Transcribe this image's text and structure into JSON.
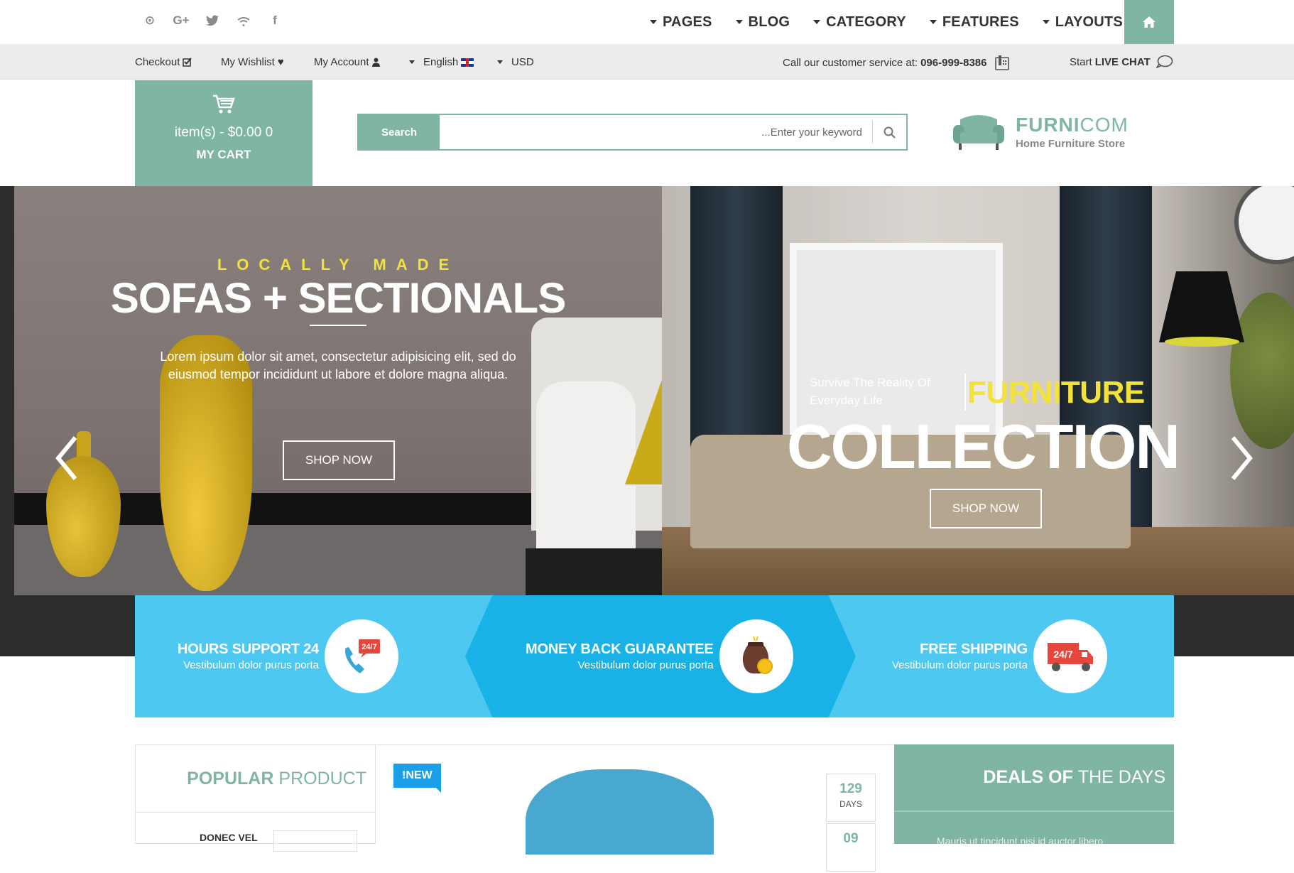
{
  "social": {
    "icons": [
      "podcast-icon",
      "google-plus-icon",
      "twitter-icon",
      "wifi-icon",
      "facebook-icon"
    ],
    "glyphs": [
      "⊙",
      "G+",
      "🐦",
      "≋",
      "f"
    ]
  },
  "nav": {
    "items": [
      "PAGES",
      "BLOG",
      "CATEGORY",
      "FEATURES",
      "LAYOUTS"
    ],
    "home_icon": "home-icon"
  },
  "util": {
    "checkout": "Checkout",
    "wishlist": "My Wishlist",
    "account": "My Account",
    "language": "English",
    "currency": "USD",
    "service_prefix": "Call our customer service at:",
    "service_phone": "096-999-8386",
    "chat_prefix": "Start",
    "chat_label": "LIVE CHAT"
  },
  "cart": {
    "items_text": "item(s) - $0.00 0",
    "label": "MY CART"
  },
  "search": {
    "button": "Search",
    "placeholder": "...Enter your keyword"
  },
  "logo": {
    "name_bold": "FURNI",
    "name_light": "COM",
    "tagline": "Home Furniture Store"
  },
  "hero": {
    "left": {
      "eyebrow": "LOCALLY MADE",
      "title": "SOFAS + SECTIONALS",
      "text": "Lorem ipsum dolor sit amet, consectetur adipisicing elit, sed do eiusmod tempor incididunt ut labore et dolore magna aliqua.",
      "cta": "SHOP NOW"
    },
    "right": {
      "survive": "Survive The Reality Of Everyday Life",
      "word1": "FURNITURE",
      "word2": "COLLECTION",
      "cta": "SHOP NOW"
    }
  },
  "features": [
    {
      "title": "HOURS SUPPORT 24",
      "sub": "Vestibulum dolor purus porta",
      "icon": "phone-24-7-icon"
    },
    {
      "title": "MONEY BACK GUARANTEE",
      "sub": "Vestibulum dolor purus porta",
      "icon": "wallet-coin-icon"
    },
    {
      "title": "FREE SHIPPING",
      "sub": "Vestibulum dolor purus porta",
      "icon": "truck-24-7-icon"
    }
  ],
  "popular": {
    "title_bold": "POPULAR",
    "title_light": "PRODUCT",
    "first_item": "DONEC VEL"
  },
  "product": {
    "badge": "!NEW"
  },
  "countdown": [
    {
      "value": "129",
      "label": "DAYS"
    },
    {
      "value": "09",
      "label": ""
    }
  ],
  "deals": {
    "title_bold": "DEALS OF",
    "title_light": "THE DAYS",
    "text": "Mauris ut tincidunt nisi id auctor libero"
  },
  "colors": {
    "accent": "#7fb5a2",
    "feature_blue": "#4cc8f1",
    "feature_blue_dark": "#19b2e6",
    "yellow": "#f3e23a",
    "badge_blue": "#19a0e6"
  }
}
